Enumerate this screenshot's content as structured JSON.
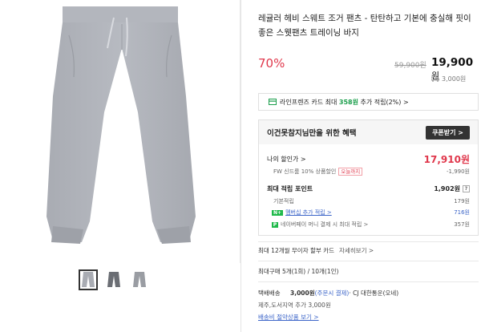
{
  "product": {
    "title": "레귤러 헤비 스웨트 조거 팬츠 - 탄탄하고 기본에 충실해 핏이 좋은 스웻팬츠 트레이닝 바지",
    "discount_rate": "70%",
    "original_price": "59,900원",
    "price_number": "19,900",
    "price_unit": "원",
    "delivery_fee": "3,000원"
  },
  "card_bar": {
    "text_prefix": "라인프렌즈 카드 최대 ",
    "points": "358원",
    "text_suffix": " 추가 적립(2%) >"
  },
  "benefit": {
    "heading": "이건못참지님만을 위한 혜택",
    "coupon_button": "쿠폰받기 >",
    "my_discount_label": "나의 할인가 >",
    "my_discount_value": "17,910원",
    "fw_coupon_label": "FW 신드룸 10% 상품할인",
    "fw_tag": "오늘까지",
    "fw_coupon_value": "-1,990원",
    "max_points_label": "최대 적립 포인트",
    "max_points_value": "1,902원",
    "help_icon": "?",
    "basic_label": "기본적립",
    "basic_value": "179원",
    "membership_badge": "N+",
    "membership_label": "멤버십 추가 적립 >",
    "membership_value": "716원",
    "npay_badge": "P",
    "npay_label": "네이버페이 머니 결제 시 최대 적립 >",
    "npay_value": "357원"
  },
  "info": {
    "installment": "최대 12개월 무이자 할부 카드",
    "installment_link": "자세히보기 >",
    "history": "최대구매 5개(1회) / 10개(1인)",
    "shipping_label": "택배배송",
    "shipping_fee": "3,000원",
    "shipping_note": "(주문시 결제)",
    "shipping_company": "· CJ 대한통운(오네)",
    "shipping_extra": "제주,도서지역 추가 3,000원",
    "bundle_link": "배송비 절약상품 보기 >"
  },
  "colors": {
    "accent_red": "#e0384c",
    "accent_green": "#1b9e4b",
    "link_blue": "#3b64c8"
  }
}
